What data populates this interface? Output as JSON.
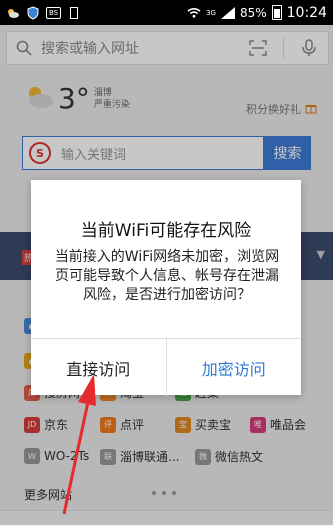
{
  "status": {
    "battery": "85%",
    "time": "10:24",
    "net": "3G",
    "box_label": "BS"
  },
  "search": {
    "placeholder": "搜索或输入网址"
  },
  "weather": {
    "temp": "3°",
    "city": "淄博",
    "quality": "严重污染",
    "points": "积分换好礼"
  },
  "search_box": {
    "placeholder": "输入关键词",
    "button": "搜索"
  },
  "banner": {
    "tag": "热"
  },
  "grid": {
    "cells": [
      {
        "label": "搜房网",
        "color": "#e65e4a",
        "glyph": "房"
      },
      {
        "label": "淘宝",
        "color": "#f08a24",
        "glyph": "淘"
      },
      {
        "label": "赶集",
        "color": "#4aa54a",
        "glyph": "赶"
      },
      {
        "label": "京东",
        "color": "#d83a3a",
        "glyph": "JD"
      },
      {
        "label": "点评",
        "color": "#f07a1a",
        "glyph": "评"
      },
      {
        "label": "买卖宝",
        "color": "#e08a20",
        "glyph": "宝"
      },
      {
        "label": "唯品会",
        "color": "#d63c7a",
        "glyph": "唯"
      },
      {
        "label": "WO-2Ts",
        "color": "#888888",
        "glyph": "W"
      },
      {
        "label": "淄博联通...",
        "color": "#888888",
        "glyph": "联"
      },
      {
        "label": "微信热文",
        "color": "#888888",
        "glyph": "微"
      }
    ],
    "more": "更多网站"
  },
  "dialog": {
    "title": "当前WiFi可能存在风险",
    "message": "当前接入的WiFi网络未加密，浏览网页可能导致个人信息、帐号存在泄漏风险，是否进行加密访问？",
    "btn_direct": "直接访问",
    "btn_encrypt": "加密访问"
  },
  "colors": {
    "accent": "#2f7ad8",
    "arrow": "#e52b2b"
  },
  "icons": [
    "weather-icon",
    "shield-icon",
    "sim-icon",
    "wifi-icon",
    "signal-icon",
    "battery-icon",
    "search-icon",
    "scan-icon",
    "mic-icon",
    "cloud-sun-icon"
  ]
}
